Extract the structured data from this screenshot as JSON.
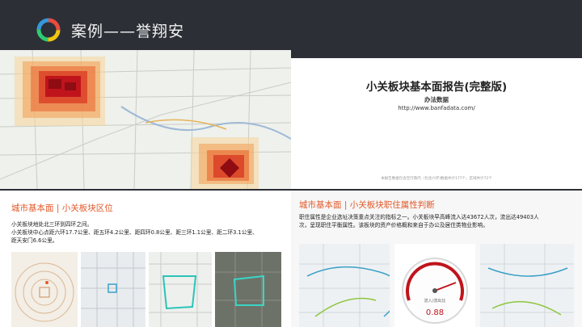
{
  "header": {
    "title": "案例——誉翔安"
  },
  "report": {
    "title": "小关板块基本面报告(完整版)",
    "subtitle": "办法数据",
    "url": "http://www.banfadata.com/",
    "footnote": "本报告数据包含至行政内（包含六环)数据共计177个，区域共计72个"
  },
  "left_panel": {
    "title": "城市基本面 | 小关板块区位",
    "lines": [
      "小关板块地处北三环到四环之间。",
      "小关板块中心点距六环17.7公里、距五环4.2公里、距四环0.8公里、距三环1.1公里、距二环3.1公里、",
      "距天安门6.6公里。"
    ]
  },
  "right_panel": {
    "title": "城市基本面 | 小关板块职住属性判断",
    "lines": [
      "职住属性是企业选址决策重点关注的指标之一。小关板块早高峰流入达43672人次，流出达49403人",
      "次，呈现职住平衡属性。该板块的资产价格概和来自于办公及居住类物业影响。"
    ],
    "gauge_value": "0.88",
    "gauge_label": "流入/流出比"
  },
  "colors": {
    "header_bg": "#2c2f36",
    "accent_orange": "#e05a2b",
    "heat_red": "#c0141c"
  }
}
